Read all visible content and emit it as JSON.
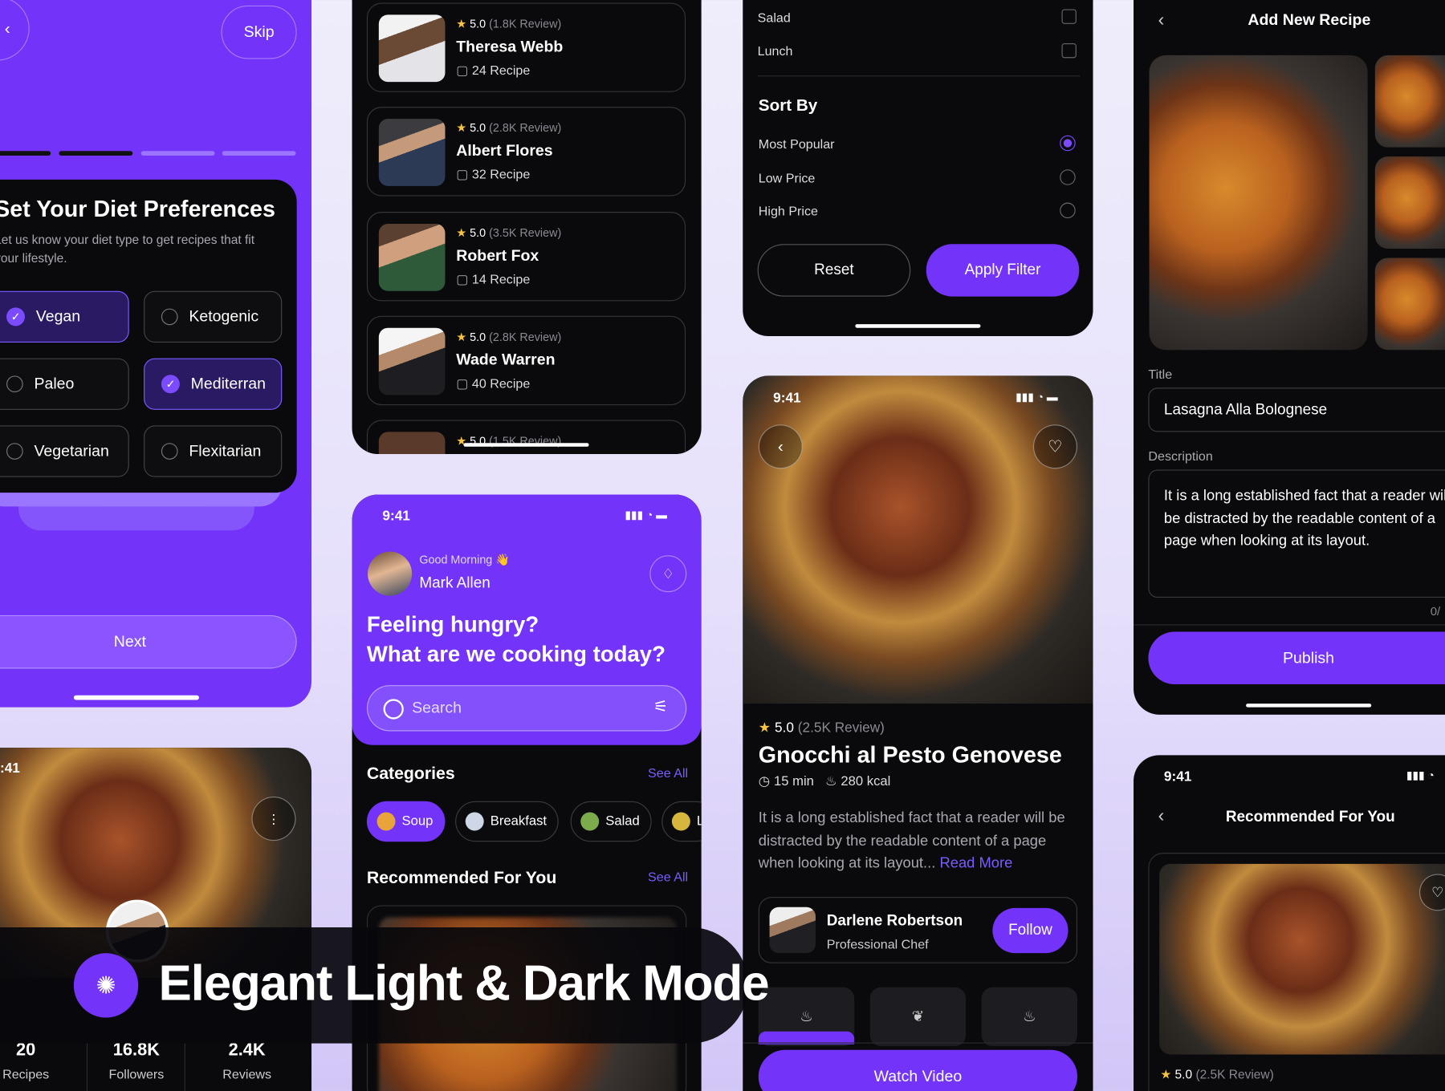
{
  "onboarding": {
    "skip_label": "Skip",
    "title": "Set Your Diet Preferences",
    "subtitle_line1": "Let us know your diet type to get recipes that fit",
    "subtitle_line2": "your lifestyle.",
    "options": [
      {
        "label": "Vegan",
        "selected": true
      },
      {
        "label": "Ketogenic",
        "selected": false
      },
      {
        "label": "Paleo",
        "selected": false
      },
      {
        "label": "Mediterran",
        "selected": true
      },
      {
        "label": "Vegetarian",
        "selected": false
      },
      {
        "label": "Flexitarian",
        "selected": false
      }
    ],
    "next_label": "Next",
    "progress_step": 2,
    "progress_total": 4
  },
  "chefs": [
    {
      "rating": "5.0",
      "reviews": "(1.8K Review)",
      "name": "Theresa Webb",
      "recipes": "24 Recipe"
    },
    {
      "rating": "5.0",
      "reviews": "(2.8K Review)",
      "name": "Albert Flores",
      "recipes": "32 Recipe"
    },
    {
      "rating": "5.0",
      "reviews": "(3.5K Review)",
      "name": "Robert Fox",
      "recipes": "14 Recipe"
    },
    {
      "rating": "5.0",
      "reviews": "(2.8K Review)",
      "name": "Wade Warren",
      "recipes": "40 Recipe"
    },
    {
      "rating": "5.0",
      "reviews": "(1.5K Review)"
    }
  ],
  "filter": {
    "categories": [
      {
        "label": "Salad",
        "checked": false
      },
      {
        "label": "Lunch",
        "checked": false
      }
    ],
    "sort_title": "Sort By",
    "sort_options": [
      {
        "label": "Most Popular",
        "selected": true
      },
      {
        "label": "Low Price",
        "selected": false
      },
      {
        "label": "High Price",
        "selected": false
      }
    ],
    "reset_label": "Reset",
    "apply_label": "Apply Filter"
  },
  "add_recipe": {
    "back_icon": "chevron-left-icon",
    "title": "Add New Recipe",
    "title_label": "Title",
    "title_value": "Lasagna Alla Bolognese",
    "description_label": "Description",
    "description_value": "It is a long established fact that a reader will be distracted by the readable content of a page when looking at its layout.",
    "counter": "0/",
    "publish_label": "Publish"
  },
  "home": {
    "time": "9:41",
    "greeting": "Good Morning 👋",
    "user_name": "Mark Allen",
    "headline_line1": "Feeling hungry?",
    "headline_line2": "What are we cooking today?",
    "search_placeholder": "Search",
    "categories_title": "Categories",
    "see_all": "See All",
    "categories": [
      "Soup",
      "Breakfast",
      "Salad",
      "L"
    ],
    "recommended_title": "Recommended For You"
  },
  "recipe_detail": {
    "time": "9:41",
    "rating": "5.0",
    "reviews": "(2.5K Review)",
    "title": "Gnocchi al Pesto Genovese",
    "duration": "15 min",
    "calories": "280 kcal",
    "description": "It is a long established fact that a reader will be distracted by the readable content of a page when looking at its layout...",
    "read_more": "Read More",
    "chef_name": "Darlene Robertson",
    "chef_role": "Professional Chef",
    "follow_label": "Follow",
    "watch_label": "Watch Video"
  },
  "profile": {
    "time": ":41",
    "stats": [
      {
        "value": "20",
        "label": "Recipes"
      },
      {
        "value": "16.8K",
        "label": "Followers"
      },
      {
        "value": "2.4K",
        "label": "Reviews"
      }
    ]
  },
  "recommended": {
    "time": "9:41",
    "title": "Recommended For You",
    "rating": "5.0",
    "reviews": "(2.5K Review)"
  },
  "banner": {
    "text": "Elegant Light & Dark Mode"
  },
  "colors": {
    "accent": "#7433F8",
    "background": "#0A0A0D",
    "star": "#F6C343"
  }
}
